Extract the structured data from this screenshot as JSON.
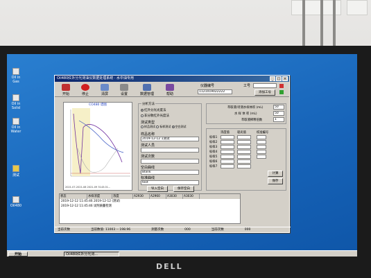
{
  "window": {
    "title": "Oil480红外分光测油仪数据处理系统 · 水中油专用",
    "buttons": [
      "_",
      "□",
      "×"
    ]
  },
  "toolbar": {
    "items": [
      {
        "label": "开始",
        "icon": "start-icon",
        "color": "#c03030"
      },
      {
        "label": "停止",
        "icon": "stop-icon",
        "color": "#d02020"
      },
      {
        "label": "清屏",
        "icon": "clear-icon",
        "color": "#6a8ac8"
      },
      {
        "label": "设置",
        "icon": "settings-icon",
        "color": "#8a8a8a"
      },
      {
        "label": "数据管理",
        "icon": "data-icon",
        "color": "#5070b0"
      },
      {
        "label": "帮助",
        "icon": "help-icon",
        "color": "#7a4aa0"
      }
    ],
    "instrument_label": "仪器编号",
    "instrument_value": "1121019022222",
    "work_label": "工号",
    "add_work_button": "添加工号"
  },
  "chart": {
    "title": "CO480 谱图",
    "footer": "2021-07-2021-08 2021-09 3143.01..."
  },
  "analysis": {
    "method_label": "分析方法",
    "method_options": [
      {
        "label": "红外分光光度法",
        "selected": true
      },
      {
        "label": "非分散红外光度法",
        "selected": false
      }
    ],
    "test_type_label": "测试类型",
    "test_type_options": [
      {
        "label": "样品测试",
        "selected": false
      },
      {
        "label": "标样测试",
        "selected": false
      },
      {
        "label": "空白测试",
        "selected": true
      }
    ],
    "sample_name_label": "样品名称",
    "sample_name_value": "2019-12-12 1测试",
    "tester_label": "测试人员",
    "tester_value": "",
    "count_label": "测试次数",
    "count_value": "",
    "blank_curve_label": "空白曲线",
    "blank_curve_value": "Blank",
    "standard_curve_label": "标准曲线",
    "standard_curve_value": "test",
    "import_blank_button": "导入空白",
    "save_blank_button": "保存空白"
  },
  "params": {
    "extract_label": "萃取液/待测水样体积 (mL)",
    "extract_value": "50",
    "water_label": "水 样 体 积 (mL)",
    "water_value": "50",
    "dilution_label": "萃取液稀释倍数",
    "dilution_value": "1",
    "table_headers": [
      "浓度值",
      "吸光值",
      "校准编号"
    ],
    "row_labels": [
      "标样1",
      "标样2",
      "标样3",
      "标样4",
      "标样5",
      "标样6",
      "标样7"
    ],
    "calc_button": "计算",
    "save_button": "保存"
  },
  "results": {
    "headers": [
      "状态",
      "水样浓度",
      "浓度",
      "A2930",
      "A2960",
      "A3030",
      "A3030"
    ],
    "rows": [
      "2019-12-12 11:45:46  2019-12-12 (测试)",
      "2019-12-12 11:45:46  试剂质量检测"
    ]
  },
  "statusbar": {
    "items": [
      "当前次数",
      "当前数值: 11003 -- 198.96",
      "测量次数",
      "000",
      "当前次数",
      "000"
    ]
  },
  "desktop_icons": [
    "Oil in Gas",
    "Oil in Solid",
    "Oil in Water",
    "测试",
    "Oil480"
  ],
  "taskbar": {
    "start_label": "开始",
    "task_label": "Oil480红外分光测..."
  },
  "monitor": {
    "brand": "DELL"
  }
}
